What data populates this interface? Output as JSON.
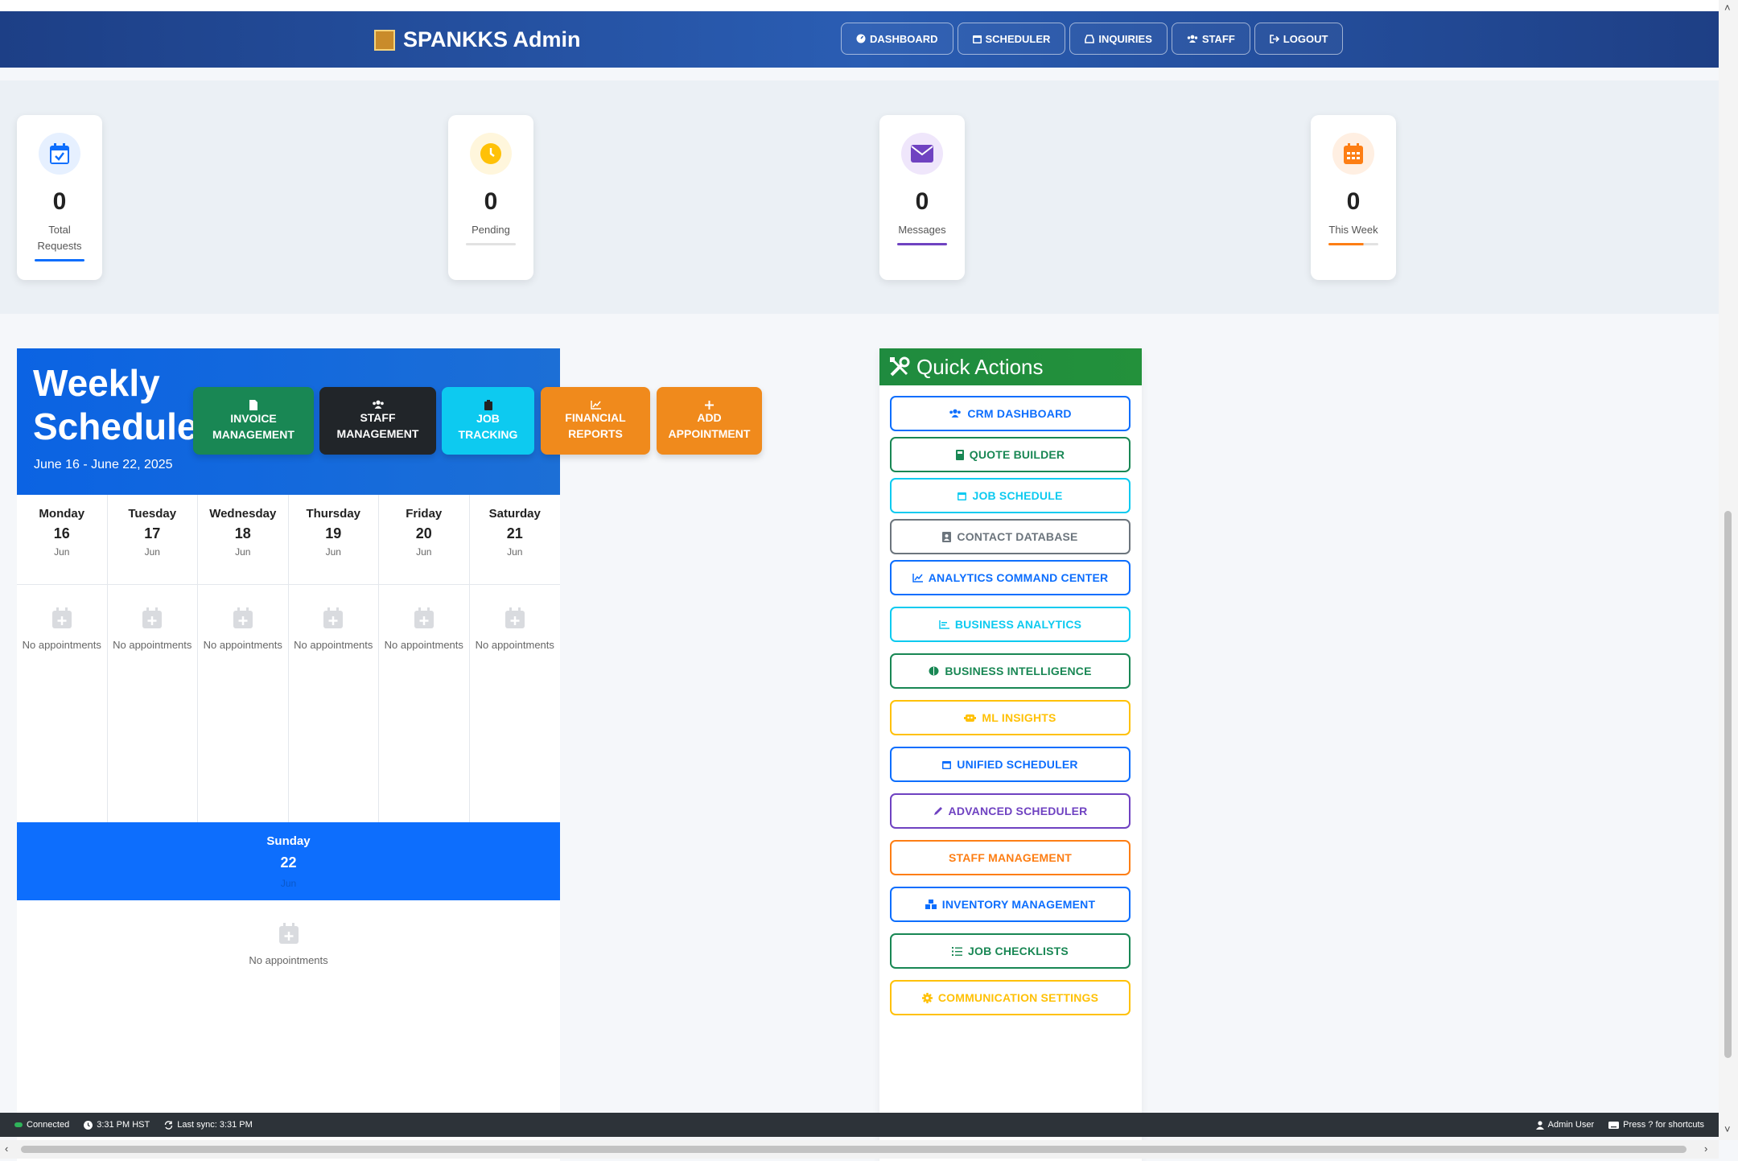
{
  "navbar": {
    "brand": "SPANKKS Admin",
    "buttons": [
      {
        "label": "DASHBOARD",
        "icon": "gauge-icon"
      },
      {
        "label": "SCHEDULER",
        "icon": "calendar-icon"
      },
      {
        "label": "INQUIRIES",
        "icon": "inbox-icon"
      },
      {
        "label": "STAFF",
        "icon": "users-icon"
      },
      {
        "label": "LOGOUT",
        "icon": "logout-icon"
      }
    ]
  },
  "stats": [
    {
      "value": "0",
      "label": "Total Requests",
      "color": "#0d6efd"
    },
    {
      "value": "0",
      "label": "Pending",
      "color": "#ffc107"
    },
    {
      "value": "0",
      "label": "Messages",
      "color": "#6f42c1"
    },
    {
      "value": "0",
      "label": "This Week",
      "color": "#fd7e14"
    }
  ],
  "weekly": {
    "title": "Weekly Schedule",
    "date_range": "June 16 - June 22, 2025",
    "action_buttons": [
      {
        "label": "INVOICE MANAGEMENT",
        "color": "#198754"
      },
      {
        "label": "STAFF MANAGEMENT",
        "color": "#212529"
      },
      {
        "label": "JOB TRACKING",
        "color": "#0dcaf0"
      },
      {
        "label": "FINANCIAL REPORTS",
        "color": "#f08a1c"
      },
      {
        "label": "ADD APPOINTMENT",
        "color": "#f08a1c"
      }
    ],
    "days": [
      {
        "name": "Monday",
        "num": "16",
        "month": "Jun",
        "empty": "No appointments"
      },
      {
        "name": "Tuesday",
        "num": "17",
        "month": "Jun",
        "empty": "No appointments"
      },
      {
        "name": "Wednesday",
        "num": "18",
        "month": "Jun",
        "empty": "No appointments"
      },
      {
        "name": "Thursday",
        "num": "19",
        "month": "Jun",
        "empty": "No appointments"
      },
      {
        "name": "Friday",
        "num": "20",
        "month": "Jun",
        "empty": "No appointments"
      },
      {
        "name": "Saturday",
        "num": "21",
        "month": "Jun",
        "empty": "No appointments"
      }
    ],
    "sunday": {
      "name": "Sunday",
      "num": "22",
      "month": "Jun",
      "empty": "No appointments"
    }
  },
  "quick_actions": {
    "title": "Quick Actions",
    "items": [
      {
        "label": "CRM DASHBOARD",
        "color": "#0d6efd",
        "icon": "users-icon"
      },
      {
        "label": "QUOTE BUILDER",
        "color": "#198754",
        "icon": "calculator-icon"
      },
      {
        "label": "JOB SCHEDULE",
        "color": "#0dcaf0",
        "icon": "calendar-icon"
      },
      {
        "label": "CONTACT DATABASE",
        "color": "#6c757d",
        "icon": "address-book-icon"
      },
      {
        "label": "ANALYTICS COMMAND CENTER",
        "color": "#0d6efd",
        "icon": "chart-line-icon"
      },
      {
        "label": "BUSINESS ANALYTICS",
        "color": "#0dcaf0",
        "icon": "chart-bar-icon"
      },
      {
        "label": "BUSINESS INTELLIGENCE",
        "color": "#198754",
        "icon": "brain-icon"
      },
      {
        "label": "ML INSIGHTS",
        "color": "#ffc107",
        "icon": "robot-icon"
      },
      {
        "label": "UNIFIED SCHEDULER",
        "color": "#0d6efd",
        "icon": "calendar-icon"
      },
      {
        "label": "ADVANCED SCHEDULER",
        "color": "#6f42c1",
        "icon": "pencil-icon"
      },
      {
        "label": "STAFF MANAGEMENT",
        "color": "#fd7e14",
        "icon": ""
      },
      {
        "label": "INVENTORY MANAGEMENT",
        "color": "#0d6efd",
        "icon": "boxes-icon"
      },
      {
        "label": "JOB CHECKLISTS",
        "color": "#198754",
        "icon": "list-check-icon"
      },
      {
        "label": "COMMUNICATION SETTINGS",
        "color": "#ffc107",
        "icon": "gear-icon"
      }
    ]
  },
  "status_bar": {
    "connected": "Connected",
    "time": "3:31 PM HST",
    "last_sync": "Last sync: 3:31 PM",
    "user": "Admin User",
    "shortcuts": "Press ? for shortcuts"
  }
}
